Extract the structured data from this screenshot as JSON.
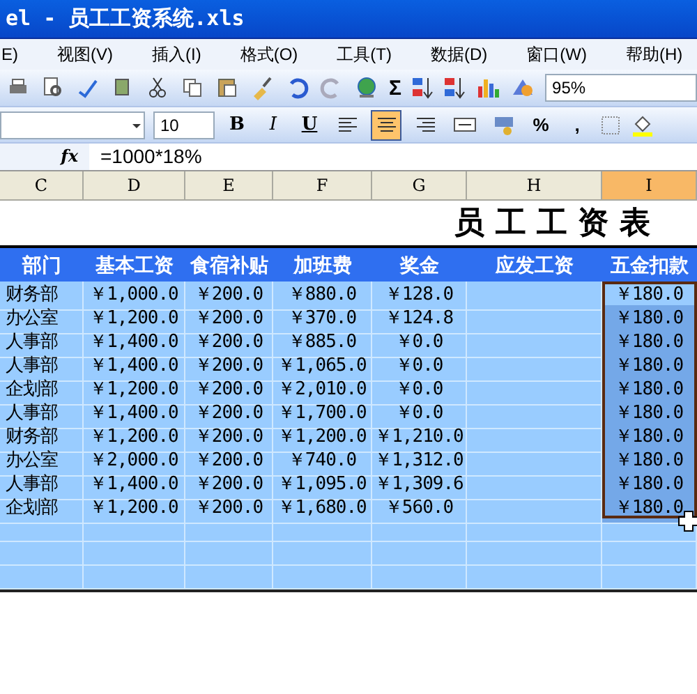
{
  "window": {
    "title": "el - 员工工资系统.xls"
  },
  "menu": [
    "E)",
    "视图(V)",
    "插入(I)",
    "格式(O)",
    "工具(T)",
    "数据(D)",
    "窗口(W)",
    "帮助(H)"
  ],
  "toolbar": {
    "sum": "Σ",
    "zoom": "95%"
  },
  "format_toolbar": {
    "font_size": "10",
    "buttons": [
      {
        "kind": "text",
        "label": "B",
        "selected": false
      },
      {
        "kind": "text",
        "label": "I",
        "selected": false
      },
      {
        "kind": "text",
        "label": "U",
        "selected": false
      },
      {
        "kind": "align-left",
        "selected": false
      },
      {
        "kind": "align-center",
        "selected": true
      },
      {
        "kind": "align-right",
        "selected": false
      },
      {
        "kind": "merge",
        "selected": false
      },
      {
        "kind": "currency",
        "selected": false
      },
      {
        "kind": "text",
        "label": "%",
        "selected": false
      },
      {
        "kind": "text",
        "label": ",",
        "selected": false
      }
    ]
  },
  "formula_bar": {
    "fx": "fx",
    "formula": "=1000*18%"
  },
  "columns": [
    {
      "label": "C",
      "selected": false
    },
    {
      "label": "D",
      "selected": false
    },
    {
      "label": "E",
      "selected": false
    },
    {
      "label": "F",
      "selected": false
    },
    {
      "label": "G",
      "selected": false
    },
    {
      "label": "H",
      "selected": false
    },
    {
      "label": "I",
      "selected": true
    }
  ],
  "sheet_title": "员 工 工 资 表",
  "table": {
    "columns": [
      "部门",
      "基本工资",
      "食宿补贴",
      "加班费",
      "奖金",
      "应发工资",
      "五金扣款"
    ],
    "rows": [
      [
        "财务部",
        "￥1,000.0",
        "￥200.0",
        "￥880.0",
        "￥128.0",
        "",
        "￥180.0"
      ],
      [
        "办公室",
        "￥1,200.0",
        "￥200.0",
        "￥370.0",
        "￥124.8",
        "",
        "￥180.0"
      ],
      [
        "人事部",
        "￥1,400.0",
        "￥200.0",
        "￥885.0",
        "￥0.0",
        "",
        "￥180.0"
      ],
      [
        "人事部",
        "￥1,400.0",
        "￥200.0",
        "￥1,065.0",
        "￥0.0",
        "",
        "￥180.0"
      ],
      [
        "企划部",
        "￥1,200.0",
        "￥200.0",
        "￥2,010.0",
        "￥0.0",
        "",
        "￥180.0"
      ],
      [
        "人事部",
        "￥1,400.0",
        "￥200.0",
        "￥1,700.0",
        "￥0.0",
        "",
        "￥180.0"
      ],
      [
        "财务部",
        "￥1,200.0",
        "￥200.0",
        "￥1,200.0",
        "￥1,210.0",
        "",
        "￥180.0"
      ],
      [
        "办公室",
        "￥2,000.0",
        "￥200.0",
        "￥740.0",
        "￥1,312.0",
        "",
        "￥180.0"
      ],
      [
        "人事部",
        "￥1,400.0",
        "￥200.0",
        "￥1,095.0",
        "￥1,309.6",
        "",
        "￥180.0"
      ],
      [
        "企划部",
        "￥1,200.0",
        "￥200.0",
        "￥1,680.0",
        "￥560.0",
        "",
        "￥180.0"
      ]
    ]
  }
}
